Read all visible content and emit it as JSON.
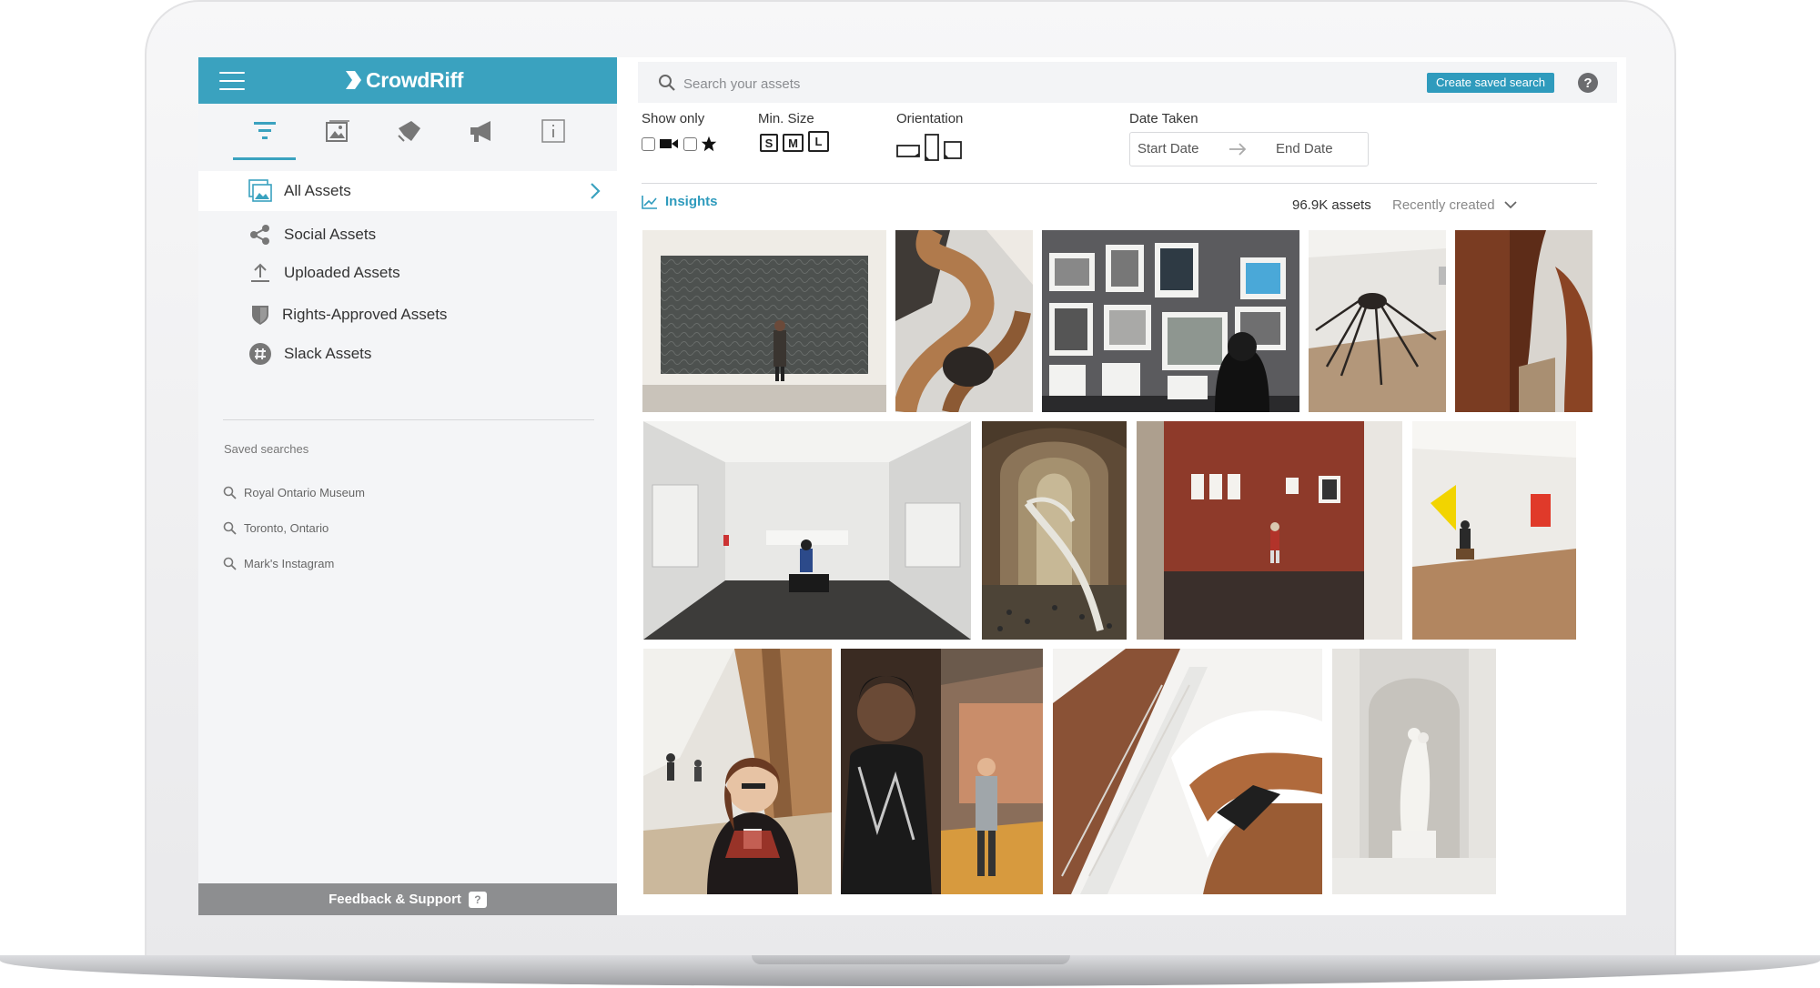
{
  "app": {
    "brand": "CrowdRiff",
    "brand_color": "#3aa2bf"
  },
  "sidebar": {
    "tabs": [
      {
        "name": "filters-icon",
        "active": true
      },
      {
        "name": "galleries-icon",
        "active": false
      },
      {
        "name": "campaigns-icon",
        "active": false
      },
      {
        "name": "megaphone-icon",
        "active": false
      },
      {
        "name": "info-icon",
        "active": false
      }
    ],
    "items": [
      {
        "label": "All Assets",
        "icon": "image-library-icon",
        "active": true
      },
      {
        "label": "Social Assets",
        "icon": "share-icon"
      },
      {
        "label": "Uploaded Assets",
        "icon": "upload-icon"
      },
      {
        "label": "Rights-Approved Assets",
        "icon": "shield-icon"
      },
      {
        "label": "Slack Assets",
        "icon": "slack-icon"
      }
    ],
    "saved_title": "Saved searches",
    "saved": [
      "Royal Ontario Museum",
      "Toronto, Ontario",
      "Mark's Instagram"
    ],
    "feedback_label": "Feedback & Support",
    "feedback_icon": "?"
  },
  "search": {
    "placeholder": "Search your assets",
    "value": "",
    "save_label": "Create saved search",
    "help": "?"
  },
  "filters": {
    "show_only_label": "Show only",
    "min_size_label": "Min. Size",
    "sizes": [
      "S",
      "M",
      "L"
    ],
    "orientation_label": "Orientation",
    "date_label": "Date Taken",
    "start_date": "Start Date",
    "end_date": "End Date"
  },
  "results": {
    "insights_label": "Insights",
    "count": "96.9K assets",
    "sort": "Recently created"
  },
  "photos": [
    {
      "desc": "gallery-wall-painting"
    },
    {
      "desc": "spiral-staircase"
    },
    {
      "desc": "photo-wall-exhibit"
    },
    {
      "desc": "spider-sculpture"
    },
    {
      "desc": "rust-steel-sculpture"
    },
    {
      "desc": "white-gallery-visitor"
    },
    {
      "desc": "museum-great-hall"
    },
    {
      "desc": "red-gallery-room"
    },
    {
      "desc": "modern-art-hall"
    },
    {
      "desc": "woman-with-coffee"
    },
    {
      "desc": "portrait-exhibit"
    },
    {
      "desc": "white-staircase"
    },
    {
      "desc": "marble-statue-niche"
    }
  ]
}
